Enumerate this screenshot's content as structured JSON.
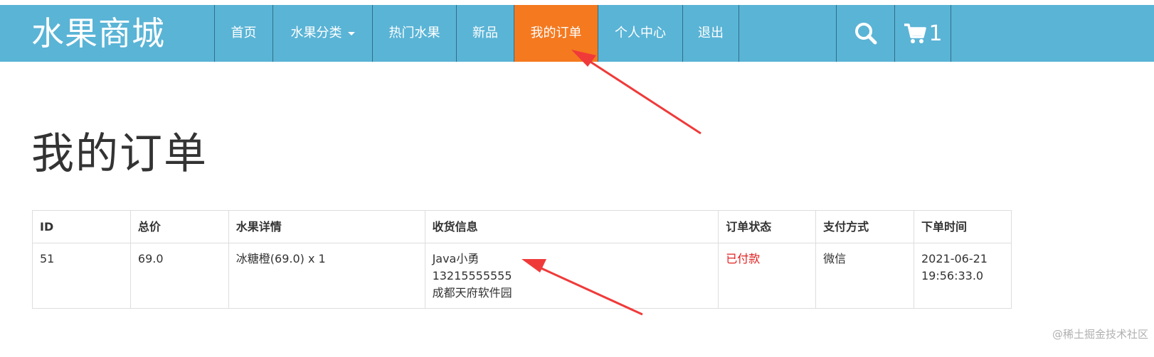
{
  "header": {
    "brand": "水果商城",
    "nav": [
      {
        "label": "首页"
      },
      {
        "label": "水果分类"
      },
      {
        "label": "热门水果"
      },
      {
        "label": "新品"
      },
      {
        "label": "我的订单"
      },
      {
        "label": "个人中心"
      },
      {
        "label": "退出"
      }
    ],
    "search_icon": "search-icon",
    "cart_icon": "cart-icon",
    "cart_count": "1",
    "colors": {
      "navbar": "#5ab4d6",
      "active": "#f4791f"
    }
  },
  "page": {
    "title": "我的订单"
  },
  "orders": {
    "columns": [
      "ID",
      "总价",
      "水果详情",
      "收货信息",
      "订单状态",
      "支付方式",
      "下单时间"
    ],
    "rows": [
      {
        "id": "51",
        "total": "69.0",
        "items": "冰糖橙(69.0) x 1",
        "recipient_name": "Java小勇",
        "recipient_phone": "13215555555",
        "recipient_address": "成都天府软件园",
        "status": "已付款",
        "payment": "微信",
        "date": "2021-06-21",
        "time": "19:56:33.0"
      }
    ],
    "status_color": "#e02020"
  },
  "annotations": {
    "arrow_color": "#f03a3a"
  },
  "watermark": "@稀土掘金技术社区"
}
